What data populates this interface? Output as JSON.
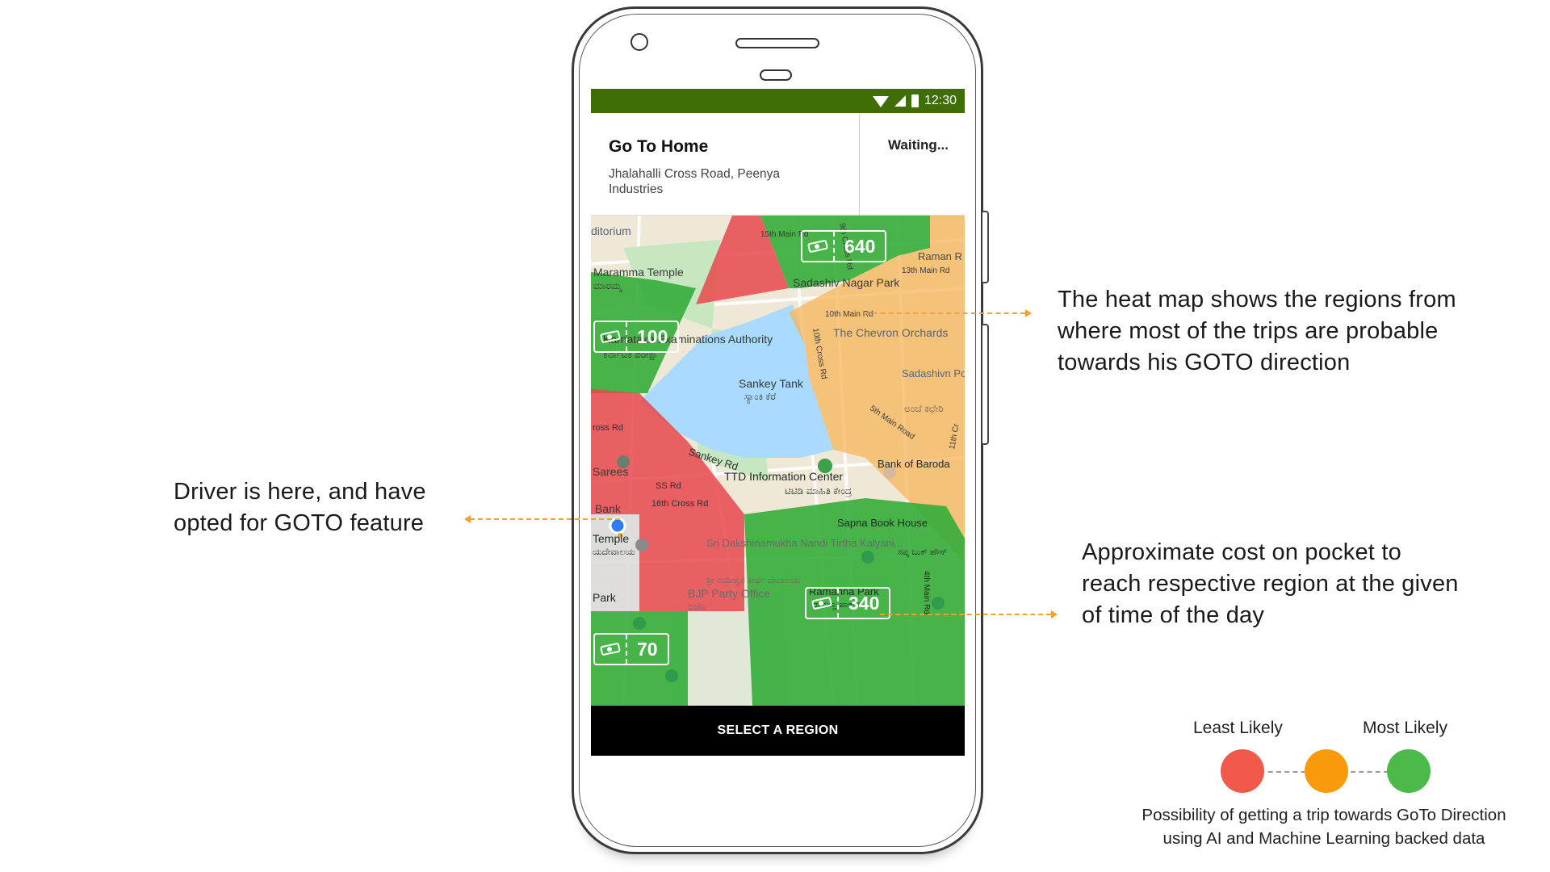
{
  "status_bar": {
    "time": "12:30"
  },
  "header": {
    "title": "Go To Home",
    "address": "Jhalahalli Cross Road, Peenya Industries",
    "status": "Waiting..."
  },
  "map": {
    "labels": {
      "auditorium": "ditorium",
      "street_15th_main": "15th Main Rd",
      "street_9th_cross": "9th Cross Rd",
      "street_13th_main": "13th Main Rd",
      "raman": "Raman R",
      "maramma_temple": "Maramma Temple",
      "maramma_temple_kn": "ಮಾರಮ್ಮ",
      "sadashiv_nagar_park": "Sadashiv Nagar Park",
      "street_10th_main": "10th Main Rd",
      "street_10th_cross": "10th Cross Rd",
      "chevron_orchards": "The Chevron Orchards",
      "karnataka_exam": "Karnataka Examinations Authority",
      "karnataka_exam_kn": "ಕರ್ನಾಟಕ ಪರೀಕ್ಷಾ",
      "sankey_tank": "Sankey Tank",
      "sankey_tank_kn": "ಸ್ಯಾಂಕಿ ಕೆರೆ",
      "sadashivnagar_po": "Sadashivn Post Office",
      "sadashivnagar_po_kn": "ಅಂಚೆ ಕಛೇರಿ",
      "street_5th_main": "5th Main Road",
      "cross_rd": "ross Rd",
      "sankey_rd": "Sankey Rd",
      "sarees": "Sarees",
      "ss_rd": "SS Rd",
      "street_16th_cross": "16th Cross Rd",
      "bank": "Bank",
      "ttd_center": "TTD Information Center",
      "ttd_center_kn": "ಟಿಟಿಡಿ ಮಾಹಿತಿ ಕೇಂದ್ರ",
      "bank_of_baroda": "Bank of Baroda",
      "sapna_book_house": "Sapna Book House",
      "sapna_kn": "ಸಪ್ನ ಬುಕ್ ಹೌಸ್",
      "temple": "Temple",
      "temple_kn": "ಯದೇವಾಲಯ",
      "sri_dakshinamukha": "Sri Dakshinamukha Nandi Tirtha Kalyani...",
      "sri_dakshinamukha_kn": "ಶ್ರೀ ನಂದೀಶ್ವರ ತೀರ್ಥ ದೇವಾಲಯ",
      "bjp_office": "BJP Party Office",
      "bjp_office_kn": "ಬಿಜೆಪಿ",
      "park": "Park",
      "ramanna_park": "Ramanna Park",
      "ramanna_park_kn": "ರಾಮಣ್ಣ ಪಾರ್ಕ್",
      "street_4th_main": "4th Main Rd",
      "street_11th_cross": "11th Cr"
    },
    "badges": [
      {
        "value": "640"
      },
      {
        "value": "100"
      },
      {
        "value": "340"
      },
      {
        "value": "70"
      }
    ]
  },
  "bottom_bar": {
    "label": "SELECT A REGION"
  },
  "annotations": {
    "heat_map_line1": "The heat map shows the regions from",
    "heat_map_line2": "where most of the trips are probable",
    "heat_map_line3": "towards his GOTO direction",
    "driver_line1": "Driver is here, and have",
    "driver_line2": "opted for GOTO feature",
    "cost_line1": "Approximate cost on pocket to",
    "cost_line2": "reach respective region at the given",
    "cost_line3": "of time of the day"
  },
  "legend": {
    "least_label": "Least Likely",
    "most_label": "Most Likely",
    "caption_line1": "Possibility of getting a trip towards GoTo Direction",
    "caption_line2": "using AI and Machine Learning backed data",
    "colors": {
      "least": "#f15a4a",
      "mid": "#f99a0c",
      "most": "#4cba48"
    }
  },
  "colors": {
    "status_bar": "#3f6e07",
    "heat_green": "#34ad3a",
    "heat_red": "#e8484d",
    "heat_orange": "#f7b55a",
    "water": "#aadaff",
    "annotation_arrow": "#f0a132"
  }
}
